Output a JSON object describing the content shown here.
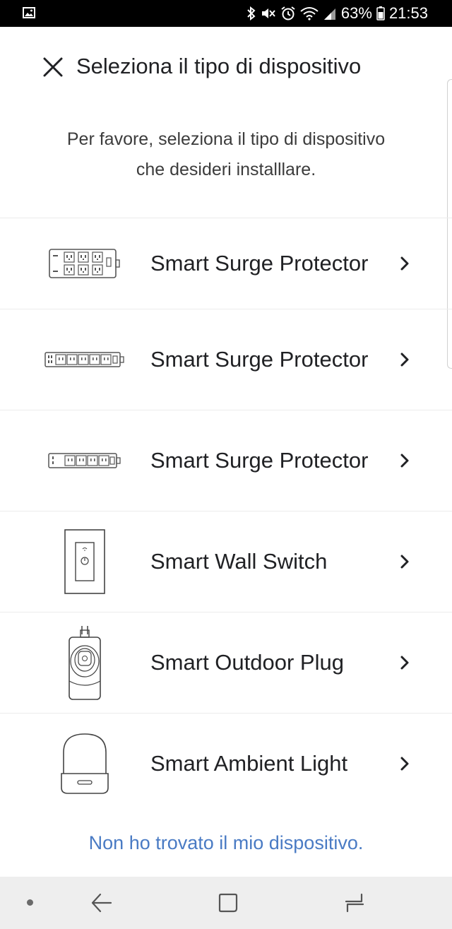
{
  "status_bar": {
    "battery_percent": "63%",
    "time": "21:53",
    "icons": [
      "image-icon",
      "bluetooth-icon",
      "mute-icon",
      "alarm-icon",
      "wifi-icon",
      "signal-icon",
      "battery-icon"
    ]
  },
  "header": {
    "title": "Seleziona il tipo di dispositivo",
    "close_icon": "close-icon"
  },
  "instructions": {
    "line1": "Per favore, seleziona il tipo di dispositivo",
    "line2": "che desideri installlare."
  },
  "devices": [
    {
      "label": "Smart Surge Protector",
      "icon": "surge-protector-12-outlet-icon"
    },
    {
      "label": "Smart Surge Protector",
      "icon": "surge-protector-6-outlet-icon"
    },
    {
      "label": "Smart Surge Protector",
      "icon": "surge-protector-4-outlet-icon"
    },
    {
      "label": "Smart Wall Switch",
      "icon": "wall-switch-icon"
    },
    {
      "label": "Smart Outdoor Plug",
      "icon": "outdoor-plug-icon"
    },
    {
      "label": "Smart Ambient Light",
      "icon": "ambient-light-icon"
    }
  ],
  "footer": {
    "not_found_link": "Non ho trovato il mio dispositivo."
  },
  "nav_bar": {
    "icons": [
      "nav-dot-icon",
      "back-icon",
      "home-icon",
      "recents-icon"
    ]
  },
  "colors": {
    "link": "#4a7bc4",
    "status_bar_bg": "#000000",
    "nav_bar_bg": "#eeeeee",
    "divider": "#ececec"
  }
}
